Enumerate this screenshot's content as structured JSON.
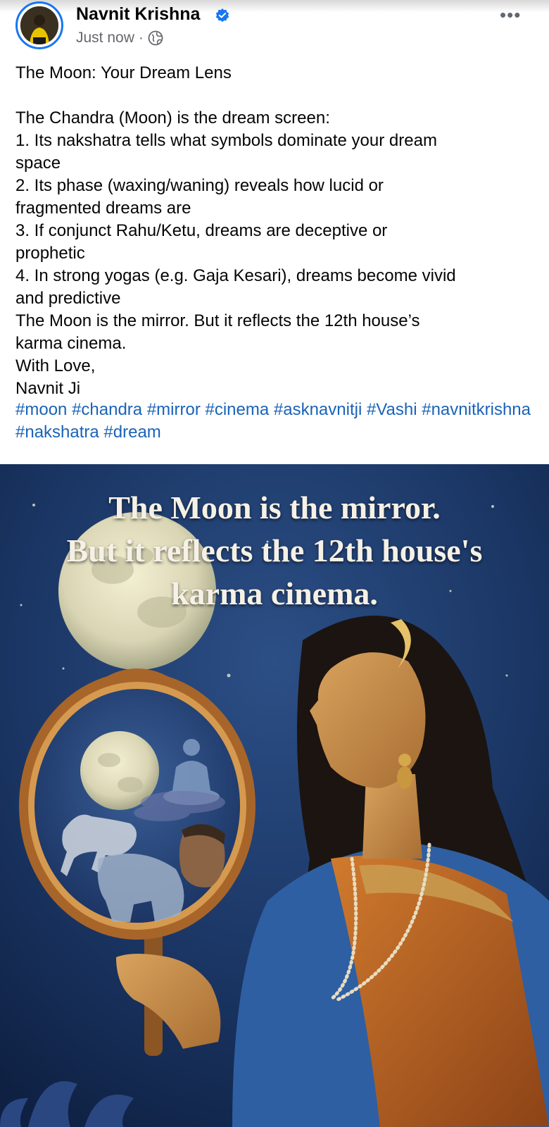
{
  "post": {
    "author": "Navnit Krishna",
    "timestamp": "Just now",
    "separator": "·",
    "more_label": "•••",
    "lines": [
      "The Moon: Your Dream Lens",
      "",
      "The Chandra (Moon) is the dream screen:",
      "1. Its nakshatra tells what symbols dominate your dream",
      "space",
      "2. Its phase (waxing/waning) reveals how lucid or",
      "fragmented dreams are",
      "3. If conjunct Rahu/Ketu, dreams are deceptive or",
      "prophetic",
      "4. In strong yogas (e.g. Gaja Kesari), dreams become vivid",
      "and predictive",
      "The Moon is the mirror. But it reflects the 12th house’s",
      "karma cinema.",
      "With Love,",
      "Navnit Ji"
    ],
    "hashtags": [
      "#moon",
      "#chandra",
      "#mirror",
      "#cinema",
      "#asknavnitji",
      "#Vashi",
      "#navnitkrishna",
      "#nakshatra",
      "#dream"
    ]
  },
  "image": {
    "caption_lines": [
      "The Moon is the mirror.",
      "But it reflects the 12th house's",
      "karma cinema."
    ]
  },
  "colors": {
    "link": "#1a63b8",
    "verified": "#1877f2",
    "muted": "#65676b"
  }
}
